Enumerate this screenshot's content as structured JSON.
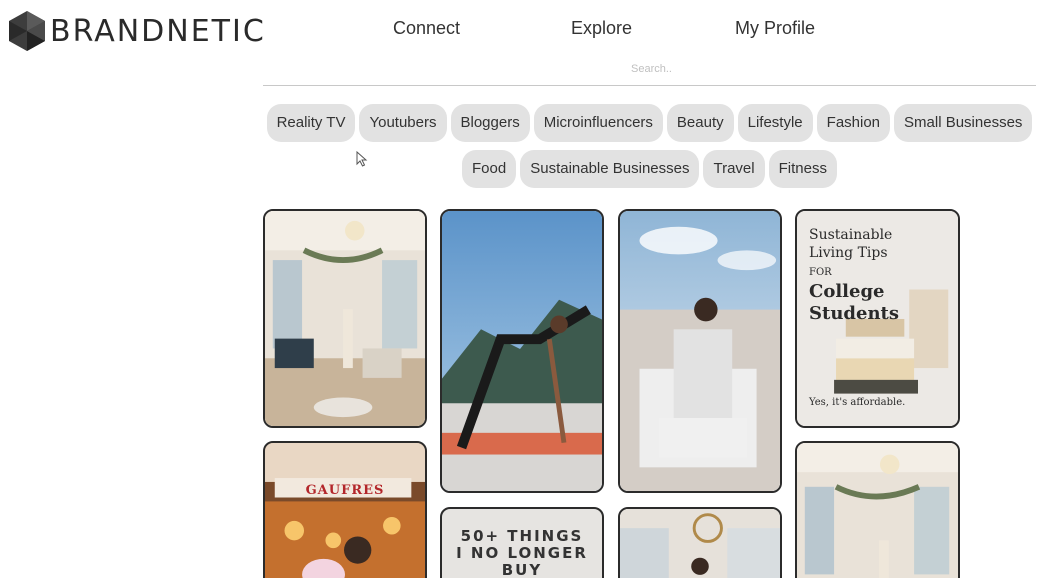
{
  "brand": {
    "name": "BRANDNETIC"
  },
  "nav": {
    "items": [
      "Connect",
      "Explore",
      "My Profile"
    ]
  },
  "search": {
    "placeholder": "Search.."
  },
  "categories": {
    "row1": [
      "Reality TV",
      "Youtubers",
      "Bloggers",
      "Microinfluencers",
      "Beauty",
      "Lifestyle",
      "Fashion",
      "Small Businesses"
    ],
    "row2": [
      "Food",
      "Sustainable Businesses",
      "Travel",
      "Fitness"
    ]
  },
  "pins": {
    "p4": {
      "line1": "Sustainable",
      "line2": "Living Tips",
      "line3": "FOR",
      "line4": "College",
      "line5": "Students",
      "footer": "Yes, it's affordable."
    },
    "p6": {
      "line1": "50+ THINGS",
      "line2": "I NO LONGER",
      "line3": "BUY"
    },
    "p5": {
      "sign": "GAUFRES"
    }
  },
  "colors": {
    "chip_bg": "#e2e2e2",
    "pin_border": "#2b2b2b",
    "accent_text": "#333333"
  }
}
